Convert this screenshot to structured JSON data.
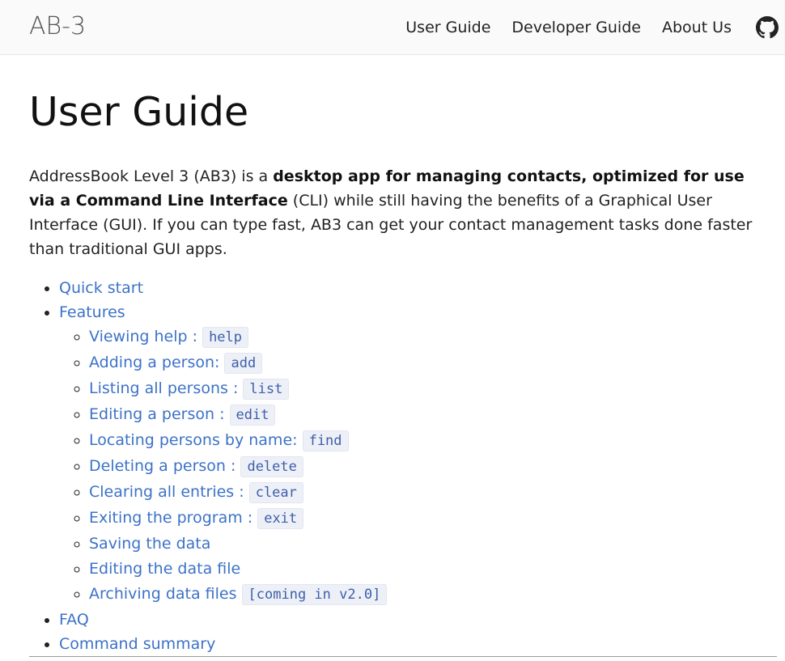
{
  "navbar": {
    "brand": "AB-3",
    "links": [
      "User Guide",
      "Developer Guide",
      "About Us"
    ]
  },
  "page": {
    "title": "User Guide",
    "intro": {
      "part1": "AddressBook Level 3 (AB3) is a ",
      "bold1": "desktop app for managing contacts, optimized for use via a Command Line Interface",
      "part2": " (CLI) while still having the benefits of a Graphical User Interface (GUI). If you can type fast, AB3 can get your contact management tasks done faster than traditional GUI apps."
    }
  },
  "toc": {
    "quick_start": "Quick start",
    "features": "Features",
    "feature_items": [
      {
        "label": "Viewing help : ",
        "code": "help"
      },
      {
        "label": "Adding a person: ",
        "code": "add"
      },
      {
        "label": "Listing all persons : ",
        "code": "list"
      },
      {
        "label": "Editing a person : ",
        "code": "edit"
      },
      {
        "label": "Locating persons by name: ",
        "code": "find"
      },
      {
        "label": "Deleting a person : ",
        "code": "delete"
      },
      {
        "label": "Clearing all entries : ",
        "code": "clear"
      },
      {
        "label": "Exiting the program : ",
        "code": "exit"
      },
      {
        "label": "Saving the data",
        "code": ""
      },
      {
        "label": "Editing the data file",
        "code": ""
      },
      {
        "label": "Archiving data files ",
        "code": "[coming in v2.0]"
      }
    ],
    "faq": "FAQ",
    "command_summary": "Command summary"
  }
}
